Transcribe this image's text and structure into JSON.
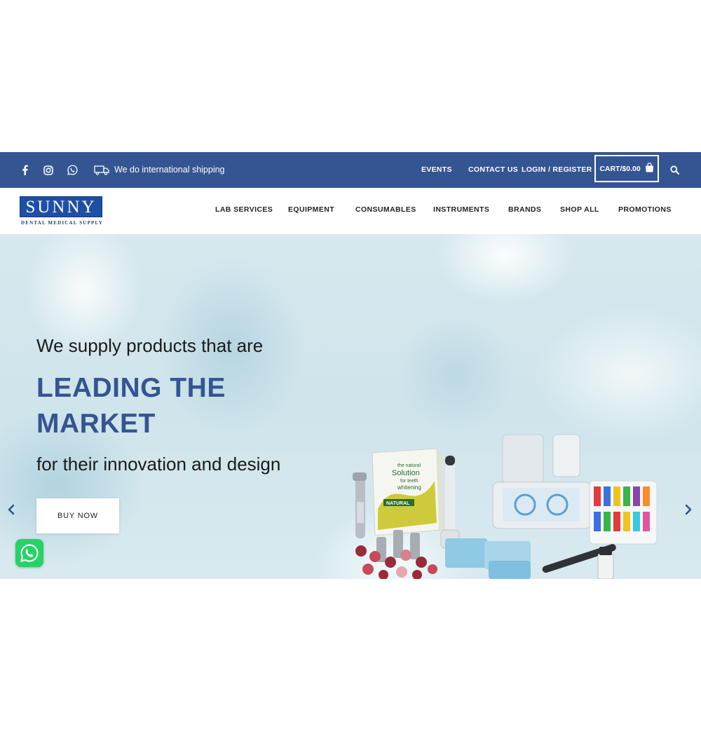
{
  "topbar": {
    "shipping_text": "We do international shipping",
    "links": [
      "EVENTS",
      "CONTACT US",
      "LOGIN / REGISTER"
    ],
    "cart_label": "CART/$0.00",
    "icons": [
      "facebook-icon",
      "instagram-icon",
      "whatsapp-icon",
      "truck-icon",
      "shopping-bag-icon",
      "search-icon"
    ],
    "bg_color": "#345592"
  },
  "brand": {
    "name": "SUNNY",
    "tagline": "DENTAL MEDICAL SUPPLY"
  },
  "nav": {
    "items": [
      "LAB SERVICES",
      "EQUIPMENT",
      "CONSUMABLES",
      "INSTRUMENTS",
      "BRANDS",
      "SHOP ALL",
      "PROMOTIONS"
    ]
  },
  "hero": {
    "line1": "We supply products that are",
    "headline_1": "LEADING THE",
    "headline_2": "MARKET",
    "line3": "for their innovation and design",
    "button_label": "BUY NOW",
    "accent_color": "#345592"
  },
  "products_image": {
    "box_text_1": "the natural",
    "box_text_2": "Solution",
    "box_text_3": "for teeth",
    "box_text_4": "whitening",
    "box_brand": "NATURAL"
  },
  "floating": {
    "whatsapp_icon": "whatsapp-icon"
  }
}
